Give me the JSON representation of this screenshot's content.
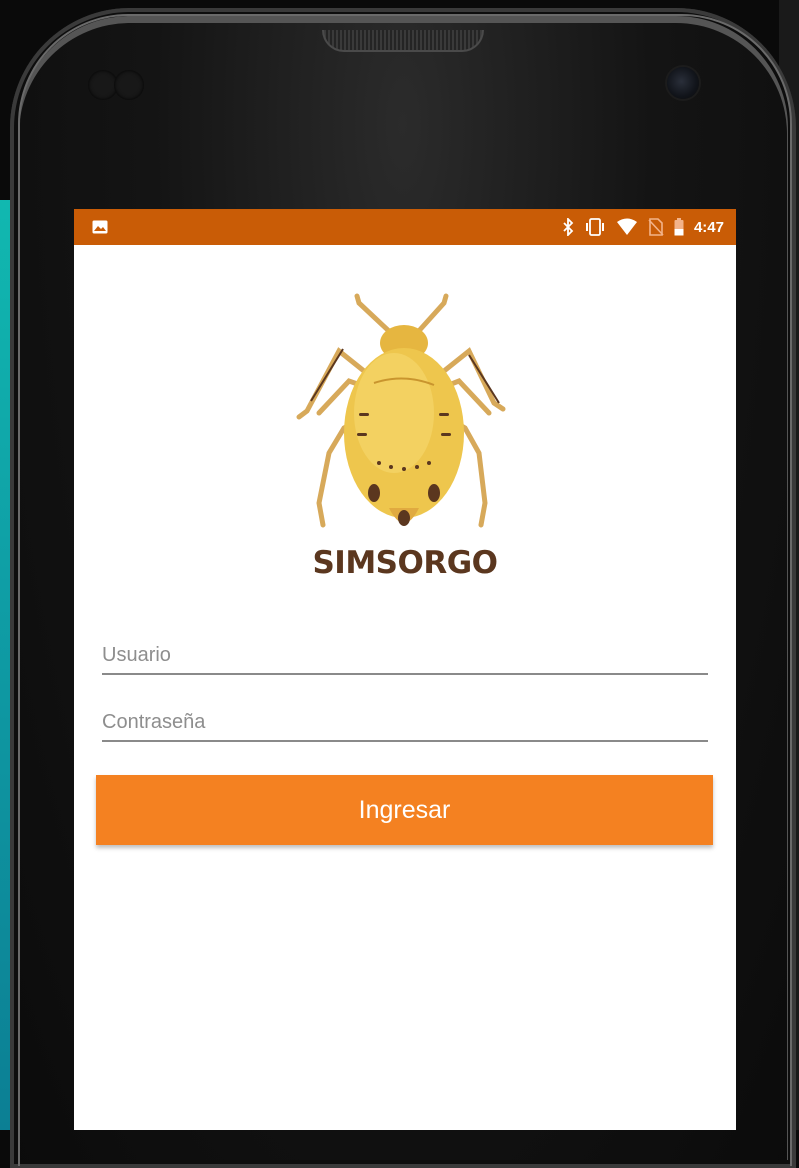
{
  "colors": {
    "status_bar": "#c95c06",
    "accent": "#f48121",
    "brand_text": "#5b371f"
  },
  "status_bar": {
    "left_icon": "image-icon",
    "icons": [
      "bluetooth-icon",
      "vibrate-icon",
      "wifi-icon",
      "no-sim-icon",
      "battery-icon"
    ],
    "time": "4:47"
  },
  "logo": {
    "icon": "aphid-icon",
    "brand": "SIMSORGO"
  },
  "form": {
    "username_placeholder": "Usuario",
    "password_placeholder": "Contraseña",
    "login_label": "Ingresar"
  }
}
